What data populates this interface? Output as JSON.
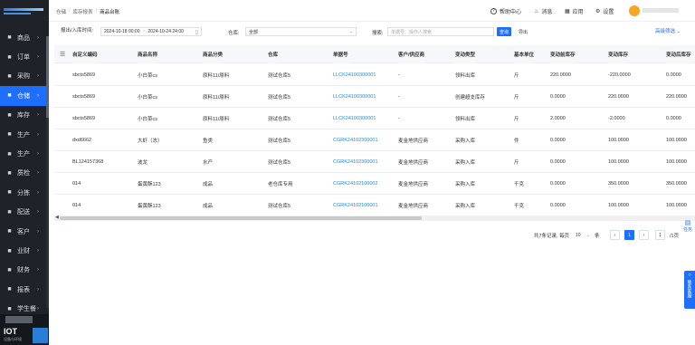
{
  "breadcrumbs": [
    "仓储",
    "库存报表",
    "商品台账"
  ],
  "header": {
    "help": "帮助中心",
    "messages": "消息",
    "apps": "应用",
    "settings": "设置"
  },
  "sidebar": [
    {
      "label": "商品",
      "icon": "grid-icon"
    },
    {
      "label": "订单",
      "icon": "document-icon"
    },
    {
      "label": "采购",
      "icon": "cart-icon"
    },
    {
      "label": "仓储",
      "icon": "warehouse-icon",
      "active": true
    },
    {
      "label": "库存",
      "icon": "box-icon"
    },
    {
      "label": "生产",
      "icon": "factory-icon"
    },
    {
      "label": "生产",
      "icon": "factory-icon"
    },
    {
      "label": "质检",
      "icon": "shield-icon"
    },
    {
      "label": "分拣",
      "icon": "sort-icon"
    },
    {
      "label": "配送",
      "icon": "truck-icon"
    },
    {
      "label": "客户",
      "icon": "user-icon"
    },
    {
      "label": "业财",
      "icon": "money-icon"
    },
    {
      "label": "财务",
      "icon": "wallet-icon"
    },
    {
      "label": "报表",
      "icon": "chart-icon"
    },
    {
      "label": "学生餐",
      "icon": "meal-icon"
    }
  ],
  "brand": {
    "name": "IOT",
    "subtitle": "设备与环境"
  },
  "filters": {
    "date_label": "报出/入库时间:",
    "date_start": "2024-10-18 00:00",
    "date_to": "~",
    "date_end": "2024-10-24 24:00",
    "warehouse_label": "仓库:",
    "warehouse_value": "全部",
    "search_label": "搜索:",
    "search_placeholder": "单据号、操作人搜索",
    "query_button": "查询",
    "export_button": "导出",
    "advanced": "高级筛选"
  },
  "table": {
    "columns": [
      "自定义编码",
      "商品名称",
      "商品分类",
      "仓库",
      "单据号",
      "客户/供应商",
      "变动类型",
      "基本单位",
      "变动前库存",
      "变动库存",
      "变动后库存"
    ],
    "rows": [
      [
        "sbcts5869",
        "小白菜cs",
        "原料11/原料",
        "测试仓库5",
        "LLCK24100300001",
        "-",
        "领料出库",
        "斤",
        "220.0000",
        "-220.0000",
        "0.0000"
      ],
      [
        "sbcts5869",
        "小白菜cs",
        "原料11/原料",
        "测试仓库5",
        "LLCK24100300001",
        "-",
        "创建超支库存",
        "斤",
        "0.0000",
        "220.0000",
        "220.0000"
      ],
      [
        "sbcts5869",
        "小白菜cs",
        "原料11/原料",
        "测试仓库5",
        "LLCK24100300001",
        "-",
        "领料出库",
        "斤",
        "2.0000",
        "-2.0000",
        "0.0000"
      ],
      [
        "dxd6662",
        "大虾（冻）",
        "鱼类",
        "测试仓库5",
        "CGRK24102300001",
        "麦金地供应商",
        "采购入库",
        "件",
        "0.0000",
        "100.0000",
        "100.0000"
      ],
      [
        "BL124157368",
        "波龙",
        "水产",
        "测试仓库5",
        "CGRK24102300001",
        "麦金地供应商",
        "采购入库",
        "斤",
        "0.0000",
        "100.0000",
        "100.0000"
      ],
      [
        "014",
        "蛋黄酥123",
        "成品",
        "老仓库专用",
        "CGRK24102100002",
        "麦金地供应商",
        "采购入库",
        "千克",
        "0.0000",
        "350.0000",
        "350.0000"
      ],
      [
        "014",
        "蛋黄酥123",
        "成品",
        "测试仓库5",
        "CGRK24102100001",
        "麦金地供应商",
        "采购入库",
        "千克",
        "0.0000",
        "100.0000",
        "100.0000"
      ]
    ]
  },
  "pagination": {
    "total": "共7条记录, 每页",
    "page_size": "10",
    "unit": "条",
    "current": "1",
    "total_pages": "/1页"
  },
  "floating": {
    "task": "任务",
    "contact": "联系客服"
  }
}
